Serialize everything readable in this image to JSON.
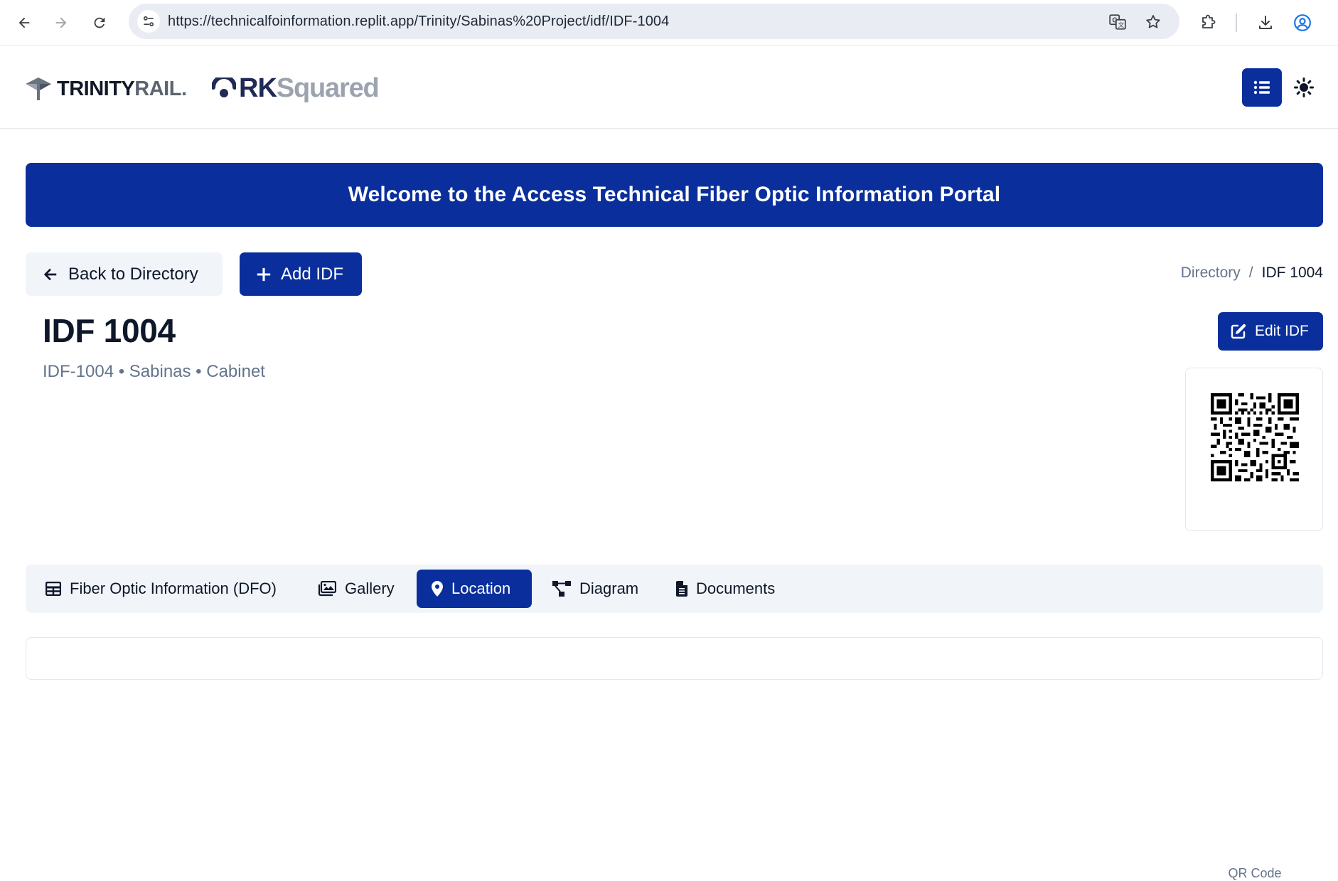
{
  "browser": {
    "url": "https://technicalfoinformation.replit.app/Trinity/Sabinas%20Project/idf/IDF-1004"
  },
  "header": {
    "logo_trinity_main": "TRINITY",
    "logo_trinity_accent": "RAIL",
    "logo_trinity_mark": ".",
    "logo_rk_main": "RK",
    "logo_rk_accent": "Squared",
    "menu_icon": "list-icon",
    "theme_icon": "sun-icon"
  },
  "banner": {
    "title": "Welcome to the Access Technical Fiber Optic Information Portal"
  },
  "actions": {
    "back_label": "Back to Directory",
    "add_label": "Add IDF",
    "edit_label": "Edit IDF"
  },
  "breadcrumb": {
    "items": [
      "Directory",
      "IDF 1004"
    ],
    "separator": "/"
  },
  "page": {
    "title": "IDF 1004",
    "subtitle": "IDF-1004 • Sabinas • Cabinet"
  },
  "qr": {
    "label": "QR Code"
  },
  "tabs": [
    {
      "label": "Fiber Optic Information (DFO)",
      "icon": "table-icon",
      "active": false
    },
    {
      "label": "Gallery",
      "icon": "images-icon",
      "active": false
    },
    {
      "label": "Location",
      "icon": "map-pin-icon",
      "active": true
    },
    {
      "label": "Diagram",
      "icon": "diagram-icon",
      "active": false
    },
    {
      "label": "Documents",
      "icon": "file-icon",
      "active": false
    }
  ],
  "colors": {
    "primary": "#0a2f9c",
    "muted_text": "#64748b",
    "surface": "#f1f5f9"
  }
}
